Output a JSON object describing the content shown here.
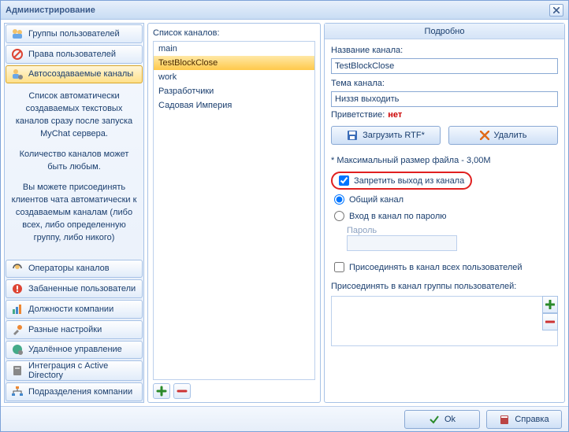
{
  "window": {
    "title": "Администрирование"
  },
  "nav": {
    "groups": "Группы пользователей",
    "rights": "Права пользователей",
    "autochannels": "Автосоздаваемые каналы",
    "operators": "Операторы каналов",
    "banned": "Забаненные пользователи",
    "positions": "Должности компании",
    "misc": "Разные настройки",
    "remote": "Удалённое управление",
    "ad": "Интеграция с Active Directory",
    "departments": "Подразделения компании"
  },
  "desc": {
    "p1": "Список автоматически создаваемых текстовых каналов сразу после запуска MyChat сервера.",
    "p2": "Количество каналов может быть любым.",
    "p3": "Вы можете присоединять клиентов чата автоматически к создаваемым каналам (либо всех, либо определенную группу, либо никого)"
  },
  "mid": {
    "label": "Список каналов:",
    "items": [
      "main",
      "TestBlockClose",
      "work",
      "Разработчики",
      "Садовая Империя"
    ],
    "selectedIndex": 1
  },
  "right": {
    "header": "Подробно",
    "name_label": "Название канала:",
    "name_value": "TestBlockClose",
    "topic_label": "Тема канала:",
    "topic_value": "Низзя выходить",
    "greeting_label": "Приветствие:",
    "greeting_value": "нет",
    "load_rtf": "Загрузить RTF*",
    "delete": "Удалить",
    "maxsize": "* Максимальный размер файла - 3,00M",
    "forbid_exit": "Запретить выход из канала",
    "public_channel": "Общий канал",
    "password_channel": "Вход в канал по паролю",
    "password_label": "Пароль",
    "join_all": "Присоединять в канал всех пользователей",
    "join_groups_label": "Присоединять в канал группы пользователей:"
  },
  "footer": {
    "ok": "Ok",
    "help": "Справка"
  }
}
